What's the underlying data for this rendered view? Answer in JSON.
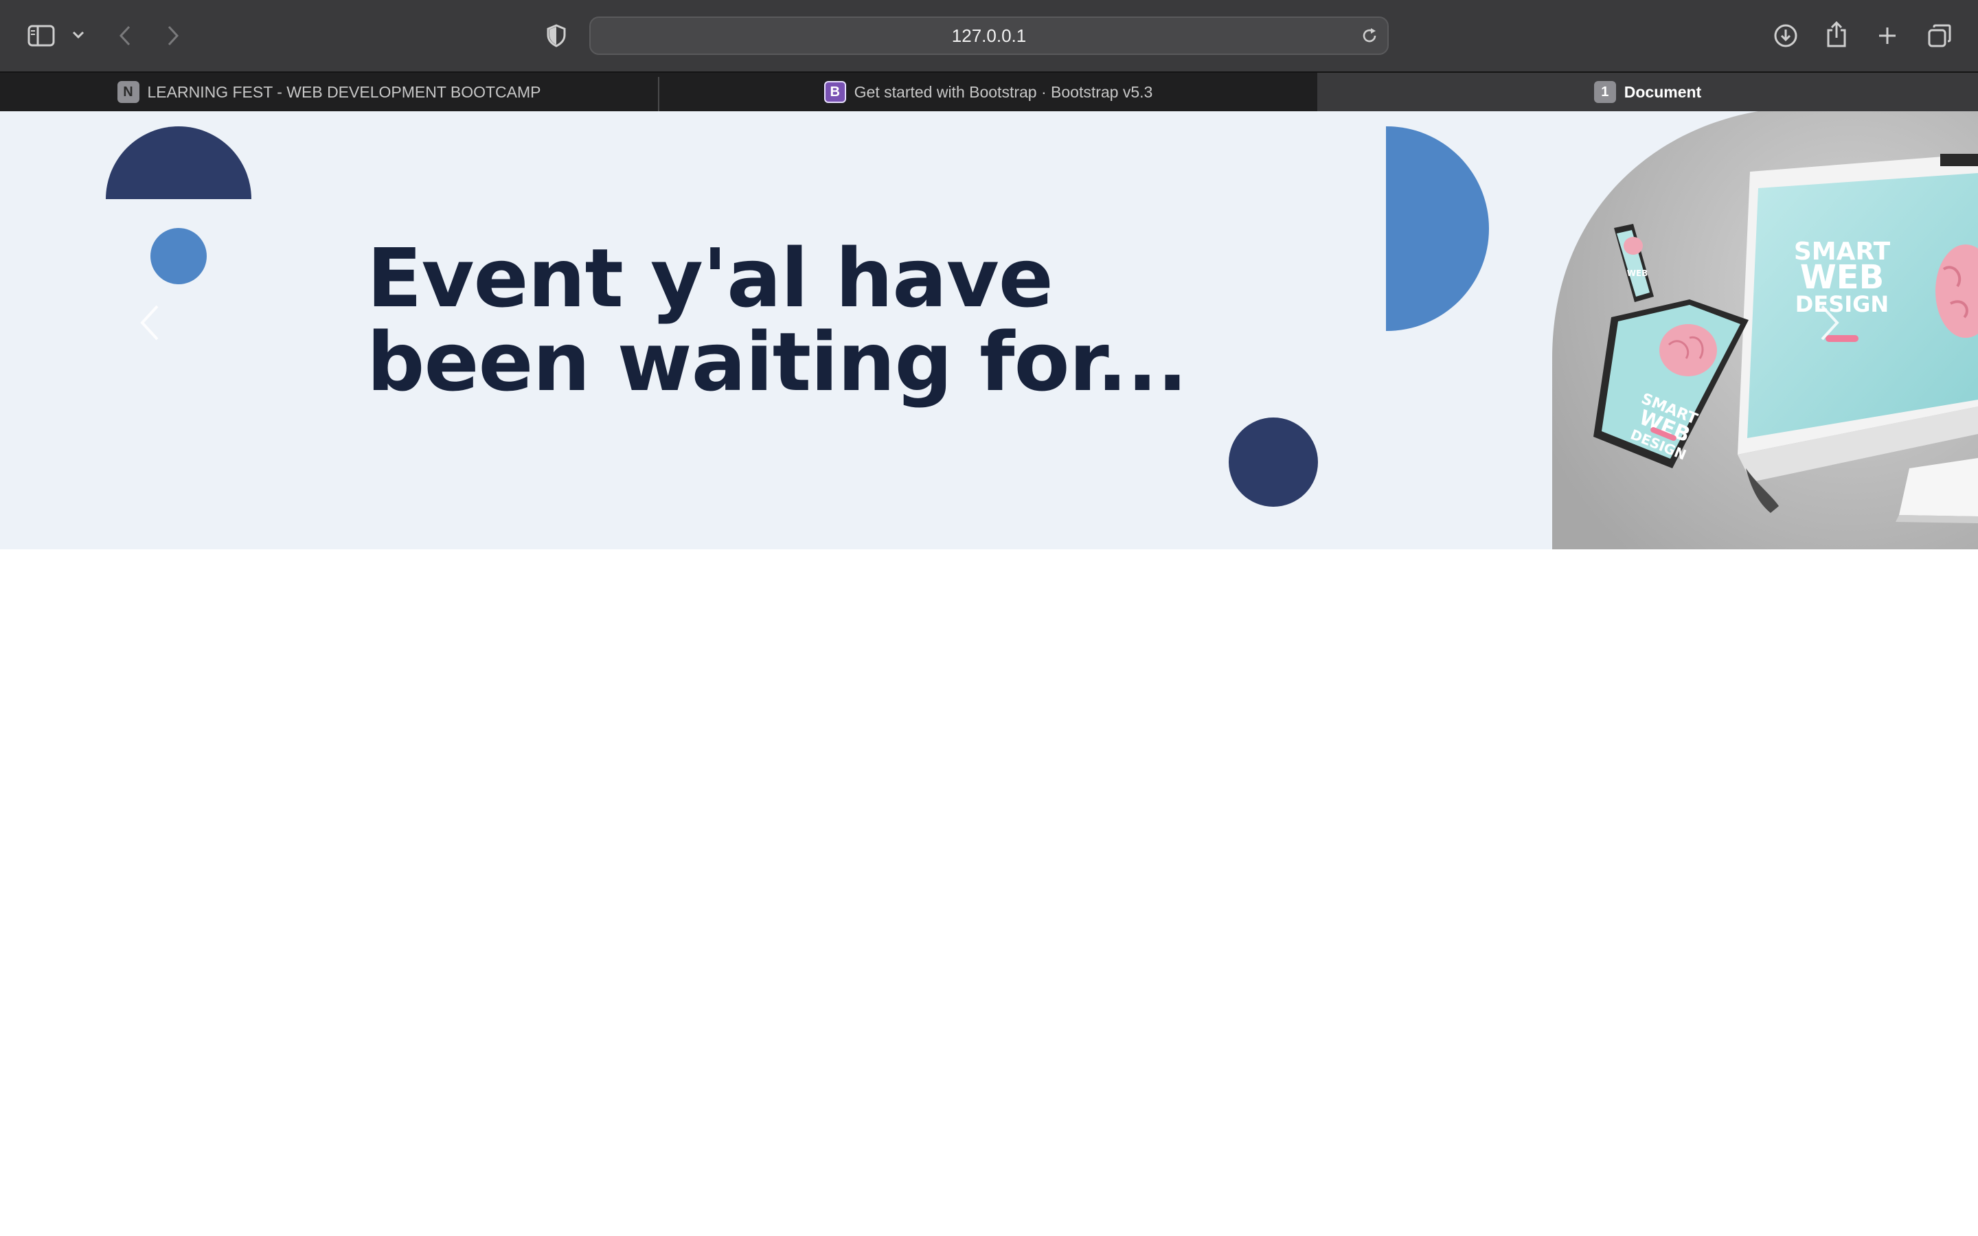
{
  "browser": {
    "url": "127.0.0.1",
    "icons": {
      "sidebar": "sidebar-icon",
      "sidebar_menu": "chevron-down-icon",
      "back": "chevron-left-icon",
      "forward": "chevron-right-icon",
      "privacy": "shield-icon",
      "reload": "reload-icon",
      "downloads": "download-icon",
      "share": "share-icon",
      "new_tab": "plus-icon",
      "tab_overview": "tabs-overview-icon"
    }
  },
  "tabs": [
    {
      "label": "LEARNING FEST - WEB DEVELOPMENT BOOTCAMP",
      "favicon": "N",
      "active": false
    },
    {
      "label": "Get started with Bootstrap · Bootstrap v5.3",
      "favicon": "B",
      "active": false
    },
    {
      "label": "Document",
      "favicon": "1",
      "active": true
    }
  ],
  "hero": {
    "headline_line1": "Event y'al have",
    "headline_line2": "been waiting for...",
    "prev_icon": "chevron-left-icon",
    "next_icon": "chevron-right-icon",
    "image_text": {
      "line1": "SMART",
      "line2": "WEB",
      "line3": "DESIGN"
    }
  },
  "colors": {
    "hero_bg": "#edf2f8",
    "navy": "#2d3c68",
    "blue": "#4f86c6",
    "headline": "#17223b"
  }
}
